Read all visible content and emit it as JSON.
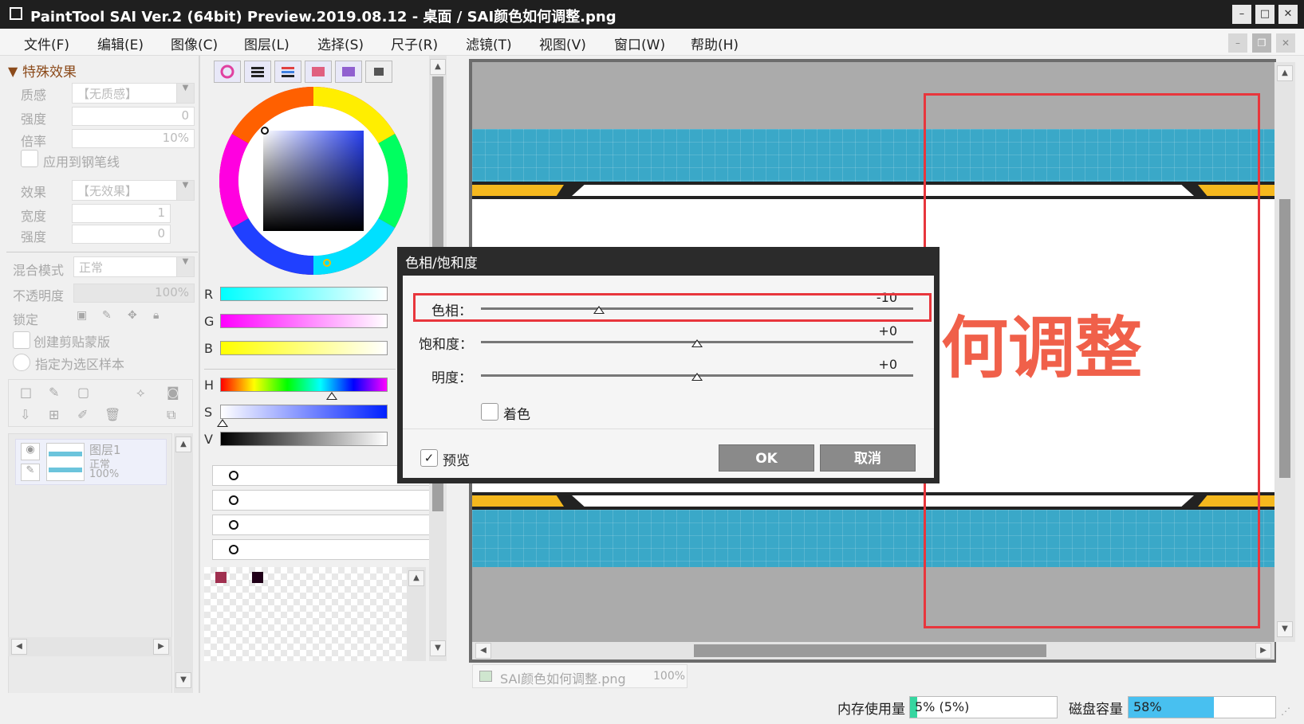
{
  "window": {
    "title": "PaintTool SAI Ver.2 (64bit) Preview.2019.08.12 - 桌面 / SAI颜色如何调整.png",
    "minimize_glyph": "–",
    "maximize_glyph": "□",
    "close_glyph": "✕",
    "mdi_min": "–",
    "mdi_restore": "❐",
    "mdi_close": "✕"
  },
  "menu": [
    "文件(F)",
    "编辑(E)",
    "图像(C)",
    "图层(L)",
    "选择(S)",
    "尺子(R)",
    "滤镜(T)",
    "视图(V)",
    "窗口(W)",
    "帮助(H)"
  ],
  "effects_panel": {
    "header": "特殊效果",
    "texture_label": "质感",
    "texture_value": "【无质感】",
    "strength_label": "强度",
    "strength_value": "0",
    "scale_label": "倍率",
    "scale_value": "10%",
    "apply_pen_label": "应用到钢笔线",
    "effect_label": "效果",
    "effect_value": "【无效果】",
    "width_label": "宽度",
    "width_value": "1",
    "strength2_label": "强度",
    "strength2_value": "0",
    "blend_label": "混合模式",
    "blend_value": "正常",
    "opacity_label": "不透明度",
    "opacity_value": "100%",
    "lock_label": "锁定",
    "clip_label": "创建剪贴蒙版",
    "sample_label": "指定为选区样本"
  },
  "layer": {
    "name": "图层1",
    "mode": "正常",
    "opacity": "100%"
  },
  "color_panel": {
    "r_label": "R",
    "g_label": "G",
    "b_label": "B",
    "h_label": "H",
    "s_label": "S",
    "v_label": "V",
    "swatches": [
      "#a03050",
      "#200018"
    ]
  },
  "canvas": {
    "text": "何调整",
    "text_color": "#f0604a",
    "band_color": "#3aa8c8",
    "stripe_color": "#f5b81e"
  },
  "dialog": {
    "title": "色相/饱和度",
    "hue_label": "色相：",
    "hue_value": "-10",
    "hue_level": -10,
    "sat_label": "饱和度：",
    "sat_value": "+0",
    "sat_level": 0,
    "bright_label": "明度：",
    "bright_value": "+0",
    "bright_level": 0,
    "colorize_label": "着色",
    "colorize_checked": false,
    "preview_label": "预览",
    "preview_checked": true,
    "ok_label": "OK",
    "cancel_label": "取消"
  },
  "doc_tab": {
    "name": "SAI颜色如何调整.png",
    "zoom": "100%"
  },
  "status": {
    "memory_label": "内存使用量",
    "memory_value": "5% (5%)",
    "memory_level": 0.05,
    "disk_label": "磁盘容量",
    "disk_value": "58%",
    "disk_level": 0.58
  },
  "colors": {
    "highlight_red": "#e8363c",
    "title_bg": "#1f1f1f"
  }
}
